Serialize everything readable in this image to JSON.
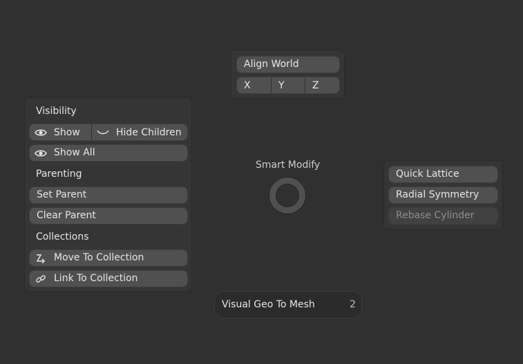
{
  "align_panel": {
    "title_button": "Align World",
    "axes": [
      "X",
      "Y",
      "Z"
    ]
  },
  "left_panel": {
    "visibility_heading": "Visibility",
    "show": "Show",
    "hide_children": "Hide Children",
    "show_all": "Show All",
    "parenting_heading": "Parenting",
    "set_parent": "Set Parent",
    "clear_parent": "Clear Parent",
    "collections_heading": "Collections",
    "move_to_collection": "Move To Collection",
    "link_to_collection": "Link To Collection"
  },
  "pie": {
    "title": "Smart Modify"
  },
  "right_panel": {
    "quick_lattice": "Quick Lattice",
    "radial_symmetry": "Radial Symmetry",
    "rebase_cylinder": "Rebase Cylinder"
  },
  "bottom_item": {
    "label": "Visual Geo To Mesh",
    "shortcut": "2"
  },
  "colors": {
    "background": "#303030",
    "button": "#505050",
    "panel": "#353535",
    "text": "#e6e6e6",
    "disabled_text": "#8e8e8e"
  }
}
